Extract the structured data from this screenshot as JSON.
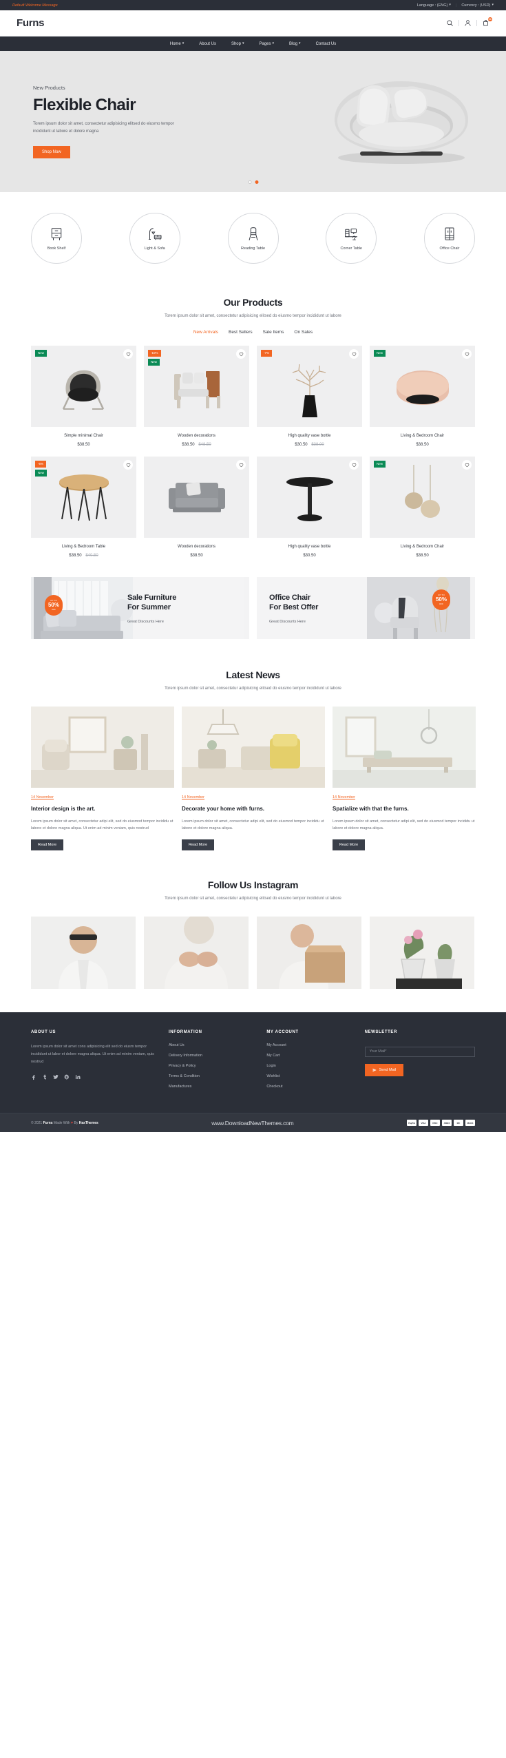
{
  "topbar": {
    "welcome": "Default Welcome Message",
    "language_label": "Language : (ENG)",
    "currency_label": "Currency : (USD)"
  },
  "header": {
    "logo": "Furns",
    "cart_count": "01"
  },
  "nav": {
    "items": [
      {
        "label": "Home",
        "caret": "⌄"
      },
      {
        "label": "About Us",
        "caret": ""
      },
      {
        "label": "Shop",
        "caret": "⌄"
      },
      {
        "label": "Pages",
        "caret": "⌄"
      },
      {
        "label": "Blog",
        "caret": "⌄"
      },
      {
        "label": "Contact Us",
        "caret": ""
      }
    ]
  },
  "hero": {
    "eyebrow": "New Products",
    "title": "Flexible Chair",
    "desc": "Torem ipsum dolor sit amet, consectetur adipisicing elitsed do eiusmo tempor incididunt ut labore et dolore magna",
    "cta": "Shop Now"
  },
  "categories": [
    {
      "label": "Book Shelf",
      "icon": "bookshelf-icon"
    },
    {
      "label": "Light & Sofa",
      "icon": "lamp-sofa-icon"
    },
    {
      "label": "Reading Table",
      "icon": "chair-icon"
    },
    {
      "label": "Corner Table",
      "icon": "desk-icon"
    },
    {
      "label": "Office Chair",
      "icon": "cabinet-icon"
    }
  ],
  "products_section": {
    "title": "Our Products",
    "subtitle": "Torem ipsum dolor sit amet, consectetur adipisicing elitsed do eiusmo tempor incididunt ut labore",
    "tabs": [
      {
        "label": "New Arrivals",
        "active": true
      },
      {
        "label": "Best Sellers",
        "active": false
      },
      {
        "label": "Sale Items",
        "active": false
      },
      {
        "label": "On Sales",
        "active": false
      }
    ],
    "items": [
      {
        "name": "Simple minimal Chair",
        "price": "$38.50",
        "old_price": "",
        "badges": [
          {
            "text": "New",
            "type": "new"
          }
        ],
        "art": "dark-lounge-chair"
      },
      {
        "name": "Wooden decorations",
        "price": "$38.50",
        "old_price": "$48.50",
        "badges": [
          {
            "text": "-10%",
            "type": "off"
          },
          {
            "text": "New",
            "type": "new"
          }
        ],
        "art": "wood-armchair"
      },
      {
        "name": "High quality vase bottle",
        "price": "$30.50",
        "old_price": "$38.00",
        "badges": [
          {
            "text": "-7%",
            "type": "off"
          }
        ],
        "art": "vase-branch"
      },
      {
        "name": "Living & Bedroom Chair",
        "price": "$38.50",
        "old_price": "",
        "badges": [
          {
            "text": "New",
            "type": "new"
          }
        ],
        "art": "pink-ottoman"
      },
      {
        "name": "Living & Bedroom Table",
        "price": "$38.50",
        "old_price": "$40.50",
        "badges": [
          {
            "text": "-5%",
            "type": "off"
          },
          {
            "text": "New",
            "type": "new"
          }
        ],
        "art": "hairpin-table"
      },
      {
        "name": "Wooden decorations",
        "price": "$38.50",
        "old_price": "",
        "badges": [],
        "art": "grey-sofa"
      },
      {
        "name": "High quality vase bottle",
        "price": "$30.50",
        "old_price": "",
        "badges": [],
        "art": "round-table"
      },
      {
        "name": "Living & Bedroom Chair",
        "price": "$38.50",
        "old_price": "",
        "badges": [
          {
            "text": "New",
            "type": "new"
          }
        ],
        "art": "pendant-lamps"
      }
    ]
  },
  "promos": [
    {
      "title_line1": "Sale Furniture",
      "title_line2": "For Summer",
      "sub": "Great Discounts Here",
      "badge_top": "UP TO",
      "badge_num": "50%",
      "badge_bottom": "OFF"
    },
    {
      "title_line1": "Office Chair",
      "title_line2": "For Best Offer",
      "sub": "Great Discounts Here",
      "badge_top": "UP TO",
      "badge_num": "50%",
      "badge_bottom": "OFF"
    }
  ],
  "news_section": {
    "title": "Latest News",
    "subtitle": "Torem ipsum dolor sit amet, consectetur adipisicing elitsed do eiusmo tempor incididunt ut labore",
    "posts": [
      {
        "date": "14 November",
        "title": "Interior design is the art.",
        "desc": "Lorem ipsum dolor sit amet, consectetur adipi elit, sed do eiusmod tempor incididu ut labore et dolore magna aliqua. Ut enim ad minim veniam, quis nostrud",
        "cta": "Read More"
      },
      {
        "date": "14 November",
        "title": "Decorate your home with furns.",
        "desc": "Lorem ipsum dolor sit amet, consectetur adipi elit, sed do eiusmod tempor incididu ut labore et dolore magna aliqua.",
        "cta": "Read More"
      },
      {
        "date": "14 November",
        "title": "Spatialize with that the furns.",
        "desc": "Lorem ipsum dolor sit amet, consectetur adipi elit, sed do eiusmod tempor incididu ut labore et dolore magna aliqua.",
        "cta": "Read More"
      }
    ]
  },
  "instagram": {
    "title": "Follow Us Instagram",
    "subtitle": "Torem ipsum dolor sit amet, consectetur adipisicing elitsed do eiusmo tempor incididunt ut labore",
    "cells": [
      {
        "alt": "man-with-sunglasses"
      },
      {
        "alt": "woman-hands-sweater"
      },
      {
        "alt": "woman-with-box"
      },
      {
        "alt": "potted-plants"
      }
    ]
  },
  "footer": {
    "about": {
      "title": "ABOUT US",
      "text": "Lorem ipsum dolor sit amet cons adipisicing elit sed do eiusm tempor incididunt ut labor et dolore magna aliqua. Ut enim ad minim veniam, quis nostrud"
    },
    "socials": [
      {
        "name": "facebook-icon"
      },
      {
        "name": "tumblr-icon"
      },
      {
        "name": "twitter-icon"
      },
      {
        "name": "pinterest-icon"
      },
      {
        "name": "linkedin-icon"
      }
    ],
    "information": {
      "title": "INFORMATION",
      "links": [
        "About Us",
        "Delivery Information",
        "Privacy & Policy",
        "Terms & Condition",
        "Manufactures"
      ]
    },
    "account": {
      "title": "MY ACCOUNT",
      "links": [
        "My Account",
        "My Cart",
        "Login",
        "Wishlist",
        "Checkout"
      ]
    },
    "newsletter": {
      "title": "NEWSLETTER",
      "placeholder": "Your Mail*",
      "value": "",
      "button": "Send Mail"
    },
    "copyright_pre": "© 2021",
    "copyright_brand": "Furns",
    "copyright_mid": "Made With",
    "copyright_by": "By",
    "copyright_author": "HasThemes",
    "site": "www.DownloadNewThemes.com",
    "cards": [
      "PayPal",
      "VISA",
      "DISC",
      "AMEX",
      "MC",
      "MAES"
    ]
  },
  "colors": {
    "accent": "#f26522",
    "dark": "#2b2f38",
    "green": "#0a8a55"
  }
}
